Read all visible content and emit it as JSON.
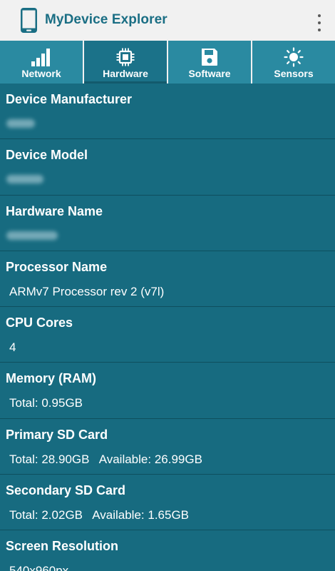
{
  "app": {
    "title": "MyDevice Explorer"
  },
  "colors": {
    "actionbar": "#f1f1f1",
    "title": "#1a6e84",
    "tab": "#2a8aa1",
    "tab_active": "#1b7289",
    "list_background": "#176b80",
    "divider": "#0e4f5e"
  },
  "tabs": [
    {
      "label": "Network",
      "icon": "signal-bars-icon"
    },
    {
      "label": "Hardware",
      "icon": "chip-icon",
      "active": true
    },
    {
      "label": "Software",
      "icon": "save-disk-icon"
    },
    {
      "label": "Sensors",
      "icon": "sun-icon"
    }
  ],
  "rows": [
    {
      "title": "Device Manufacturer",
      "value": ""
    },
    {
      "title": "Device Model",
      "value": ""
    },
    {
      "title": "Hardware Name",
      "value": ""
    },
    {
      "title": "Processor Name",
      "value": "ARMv7 Processor rev 2 (v7l)"
    },
    {
      "title": "CPU Cores",
      "value": "4"
    },
    {
      "title": "Memory (RAM)",
      "value": "Total: 0.95GB"
    },
    {
      "title": "Primary SD Card",
      "value": "Total: 28.90GB   Available: 26.99GB"
    },
    {
      "title": "Secondary SD Card",
      "value": "Total: 2.02GB   Available: 1.65GB"
    },
    {
      "title": "Screen Resolution",
      "value": "540x960px"
    }
  ]
}
